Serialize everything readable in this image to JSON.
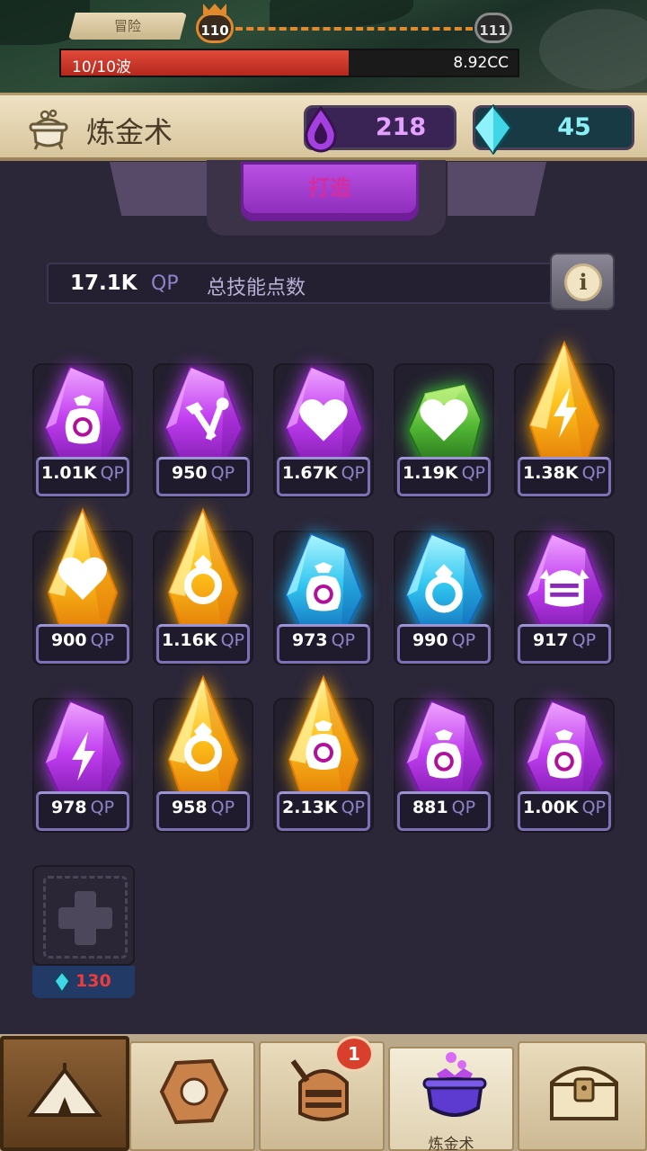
{
  "adventure": {
    "tab_label": "冒险",
    "current_stage": "110",
    "next_stage": "111",
    "wave_label": "10/10波",
    "wave_value": "8.92CC",
    "wave_progress": 0.63
  },
  "header": {
    "title": "炼金术",
    "elixir": "218",
    "gems": "45"
  },
  "craft": {
    "label": "打造"
  },
  "skill_points": {
    "value": "17.1K",
    "unit": "QP",
    "label": "总技能点数",
    "info_icon": "i"
  },
  "gems": [
    {
      "qp": "1.01K",
      "unit": "QP",
      "color": "purple",
      "shape": "crystal",
      "symbol": "bag-icon"
    },
    {
      "qp": "950",
      "unit": "QP",
      "color": "purple",
      "shape": "crystal",
      "symbol": "hammer-icon"
    },
    {
      "qp": "1.67K",
      "unit": "QP",
      "color": "purple",
      "shape": "crystal",
      "symbol": "heart-icon"
    },
    {
      "qp": "1.19K",
      "unit": "QP",
      "color": "green",
      "shape": "stone",
      "symbol": "heart-icon"
    },
    {
      "qp": "1.38K",
      "unit": "QP",
      "color": "gold",
      "shape": "tall",
      "symbol": "lightning-icon"
    },
    {
      "qp": "900",
      "unit": "QP",
      "color": "gold",
      "shape": "tall",
      "symbol": "heart-icon"
    },
    {
      "qp": "1.16K",
      "unit": "QP",
      "color": "gold",
      "shape": "tall",
      "symbol": "ring-icon"
    },
    {
      "qp": "973",
      "unit": "QP",
      "color": "cyan",
      "shape": "crystal",
      "symbol": "bag-icon"
    },
    {
      "qp": "990",
      "unit": "QP",
      "color": "cyan",
      "shape": "crystal",
      "symbol": "ring-icon"
    },
    {
      "qp": "917",
      "unit": "QP",
      "color": "purple",
      "shape": "crystal",
      "symbol": "helmet-icon"
    },
    {
      "qp": "978",
      "unit": "QP",
      "color": "purple",
      "shape": "crystal",
      "symbol": "lightning-icon"
    },
    {
      "qp": "958",
      "unit": "QP",
      "color": "gold",
      "shape": "tall",
      "symbol": "ring-icon"
    },
    {
      "qp": "2.13K",
      "unit": "QP",
      "color": "gold",
      "shape": "tall",
      "symbol": "bag-icon"
    },
    {
      "qp": "881",
      "unit": "QP",
      "color": "purple",
      "shape": "crystal",
      "symbol": "bag-icon"
    },
    {
      "qp": "1.00K",
      "unit": "QP",
      "color": "purple",
      "shape": "crystal",
      "symbol": "bag-icon"
    }
  ],
  "add_slot": {
    "cost": "130",
    "icon": "plus-icon"
  },
  "colors": {
    "purple": [
      "#f0a6ff",
      "#c03df0",
      "#7a19a8",
      "#b43cf0"
    ],
    "gold": [
      "#fff3a0",
      "#ffc21a",
      "#e27a08",
      "#ffb000"
    ],
    "cyan": [
      "#aef6ff",
      "#2fc5f0",
      "#1268b8",
      "#20c0ff"
    ],
    "green": [
      "#b8f07a",
      "#52b834",
      "#25701c",
      "#40d040"
    ]
  },
  "nav": {
    "items": [
      {
        "name": "home",
        "icon": "tent-icon",
        "label": ""
      },
      {
        "name": "relics",
        "icon": "stone-icon",
        "label": ""
      },
      {
        "name": "heroes",
        "icon": "knight-helmet-icon",
        "label": "",
        "badge": "1"
      },
      {
        "name": "alchemy",
        "icon": "cauldron-icon",
        "label": "炼金术"
      },
      {
        "name": "chest",
        "icon": "chest-icon",
        "label": ""
      }
    ]
  }
}
